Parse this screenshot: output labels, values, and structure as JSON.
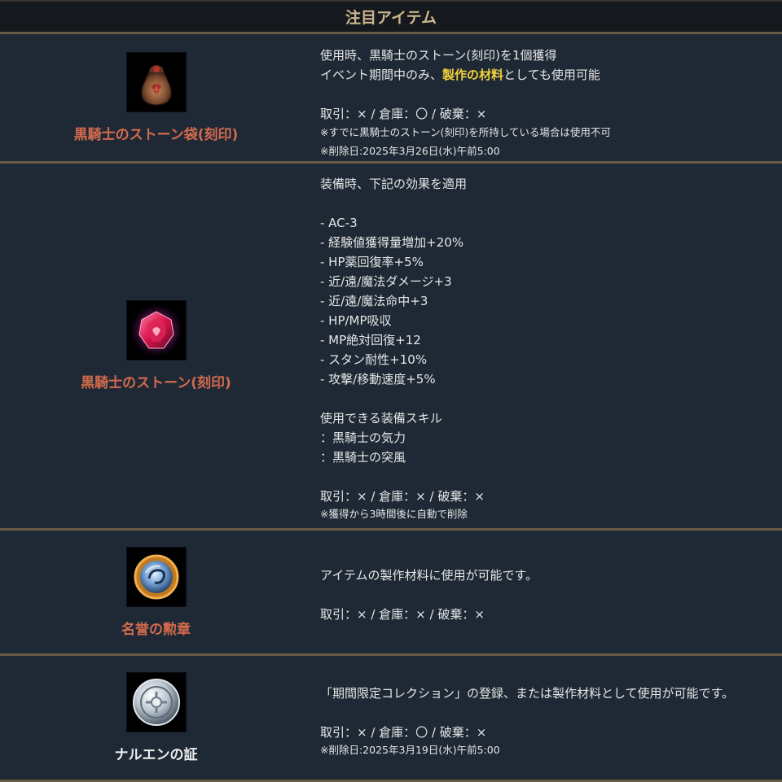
{
  "header": {
    "title": "注目アイテム"
  },
  "colors": {
    "accent_name": "#d36a4d",
    "highlight": "#f2d13a",
    "separator": "#6b5a47",
    "background": "#1e2935"
  },
  "items": [
    {
      "name": "黒騎士のストーン袋(刻印)",
      "icon": "stone-pouch-icon",
      "desc_line1": "使用時、黒騎士のストーン(刻印)を1個獲得",
      "desc_line2_pre": "イベント期間中のみ、",
      "desc_line2_hl": "製作の材料",
      "desc_line2_post": "としても使用可能",
      "trade": "取引：× / 倉庫：〇 / 破棄：×",
      "note1": "※すでに黒騎士のストーン(刻印)を所持している場合は使用不可",
      "note2": "※削除日:2025年3月26日(水)午前5:00"
    },
    {
      "name": "黒騎士のストーン(刻印)",
      "icon": "red-gem-icon",
      "intro": "装備時、下記の効果を適用",
      "effects": [
        "- AC-3",
        "- 経験値獲得量増加+20%",
        "- HP薬回復率+5%",
        "- 近/遠/魔法ダメージ+3",
        "- 近/遠/魔法命中+3",
        "- HP/MP吸収",
        "- MP絶対回復+12",
        "- スタン耐性+10%",
        "- 攻撃/移動速度+5%"
      ],
      "skills_title": "使用できる装備スキル",
      "skills": [
        "：黒騎士の気力",
        "：黒騎士の突風"
      ],
      "trade": "取引：× / 倉庫：× / 破棄：×",
      "note1": "※獲得から3時間後に自動で削除"
    },
    {
      "name": "名誉の勲章",
      "icon": "medal-icon",
      "desc": "アイテムの製作材料に使用が可能です。",
      "trade": "取引：× / 倉庫：× / 破棄：×"
    },
    {
      "name": "ナルエンの証",
      "icon": "silver-coin-icon",
      "desc": "「期間限定コレクション」の登録、または製作材料として使用が可能です。",
      "trade": "取引：× / 倉庫：〇 / 破棄：×",
      "note1": "※削除日:2025年3月19日(水)午前5:00"
    }
  ]
}
